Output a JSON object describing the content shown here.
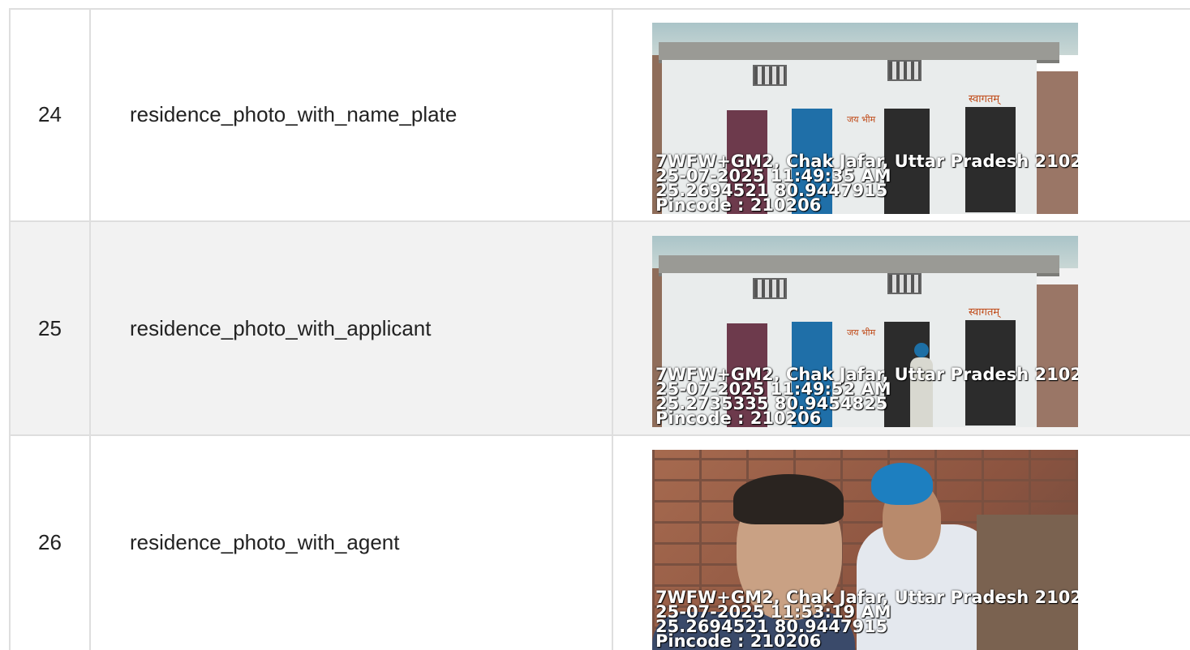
{
  "rows": [
    {
      "number": "24",
      "label": "residence_photo_with_name_plate",
      "photo": {
        "scene": "house-front",
        "banner_text": "स्वागतम्",
        "side_text": "जय भीम",
        "overlay_lines": [
          "7WFW+GM2, Chak Jafar, Uttar Pradesh 2102",
          "25-07-2025 11:49:35 AM",
          "25.2694521 80.9447915",
          "Pincode : 210206"
        ]
      }
    },
    {
      "number": "25",
      "label": "residence_photo_with_applicant",
      "photo": {
        "scene": "house-front-with-person",
        "banner_text": "स्वागतम्",
        "side_text": "जय भीम",
        "overlay_lines": [
          "7WFW+GM2, Chak Jafar, Uttar Pradesh 2102",
          "25-07-2025 11:49:52 AM",
          "25.2735335 80.9454825",
          "Pincode : 210206"
        ]
      }
    },
    {
      "number": "26",
      "label": "residence_photo_with_agent",
      "photo": {
        "scene": "selfie-brick-wall",
        "overlay_lines": [
          "7WFW+GM2, Chak Jafar, Uttar Pradesh 2102",
          "25-07-2025 11:53:19 AM",
          "25.2694521 80.9447915",
          "Pincode : 210206"
        ]
      }
    }
  ],
  "colors": {
    "border": "#dedede",
    "alt_row": "#f2f2f2",
    "text": "#222222"
  }
}
